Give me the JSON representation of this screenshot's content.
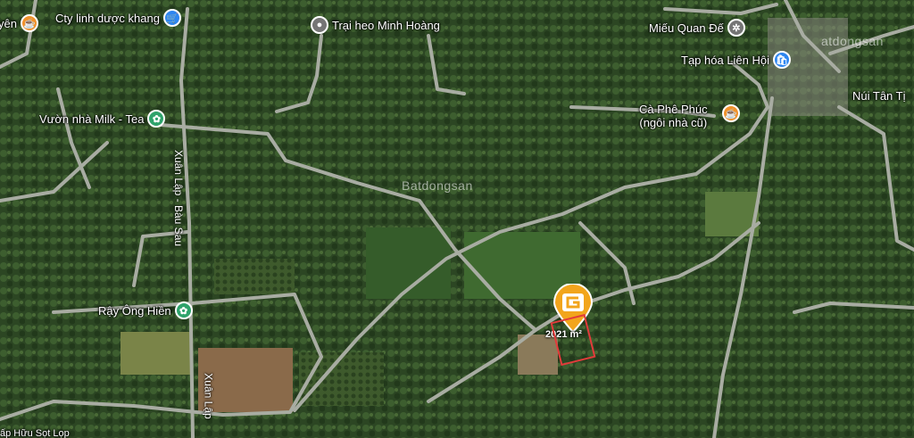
{
  "colors": {
    "orange": "#f0922c",
    "blue": "#2e86f0",
    "green": "#2fa36b",
    "gray": "#757575",
    "marker": "#f2a51c"
  },
  "pois": [
    {
      "label": "yên",
      "icon": "coffee-icon",
      "color": "orange"
    },
    {
      "label": "Cty linh dược khang",
      "icon": "shopping-cart-icon",
      "color": "blue"
    },
    {
      "label": "Trại heo Minh Hoàng",
      "icon": "place-icon",
      "color": "gray"
    },
    {
      "label": "Miếu Quan Đế",
      "icon": "temple-icon",
      "color": "gray"
    },
    {
      "label": "Tạp hóa Liên Hội",
      "icon": "shopping-bag-icon",
      "color": "blue"
    },
    {
      "label": "Vườn nhà Milk - Tea",
      "icon": "flower-icon",
      "color": "green"
    },
    {
      "label": "Cà Phê Phúc",
      "icon": "",
      "color": ""
    },
    {
      "label": "(ngôi nhà cũ)",
      "icon": "coffee-icon",
      "color": "orange"
    },
    {
      "label": "Rậy Ông Hiền",
      "icon": "flower-icon",
      "color": "green"
    },
    {
      "label": "Núi Tân Tị",
      "icon": "",
      "color": ""
    }
  ],
  "roads": [
    "Xuân Lập - Bàu Sau",
    "Xuân Lập"
  ],
  "watermarks": [
    "Batdongsan",
    "atdongsan"
  ],
  "marker": {
    "icon": "g-logo-icon",
    "area": "2021 m²"
  },
  "bottom_text": "ấp Hữu Sọt Lọp"
}
